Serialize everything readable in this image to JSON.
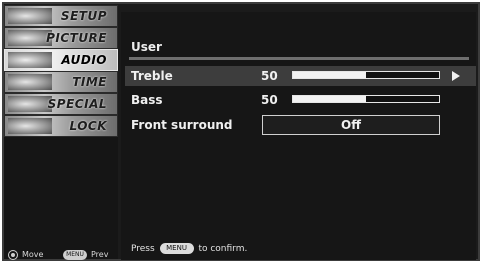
{
  "sidebar": {
    "items": [
      {
        "label": "SETUP",
        "active": false
      },
      {
        "label": "PICTURE",
        "active": false
      },
      {
        "label": "AUDIO",
        "active": true
      },
      {
        "label": "TIME",
        "active": false
      },
      {
        "label": "SPECIAL",
        "active": false
      },
      {
        "label": "LOCK",
        "active": false
      }
    ],
    "legend": {
      "move_label": "Move",
      "menu_key_label": "MENU",
      "prev_label": "Prev"
    }
  },
  "panel": {
    "title": "User",
    "rows": [
      {
        "label": "Treble",
        "value": "50",
        "level_fraction": 0.5,
        "selected": true
      },
      {
        "label": "Bass",
        "value": "50",
        "level_fraction": 0.5,
        "selected": false
      },
      {
        "label": "Front surround",
        "option": "Off",
        "selected": false
      }
    ],
    "footer": {
      "prefix": "Press",
      "menu_key_label": "MENU",
      "suffix": "to confirm."
    }
  },
  "icons": [
    "right-arrow-icon",
    "navigation-pad-icon",
    "menu-key-icon"
  ]
}
